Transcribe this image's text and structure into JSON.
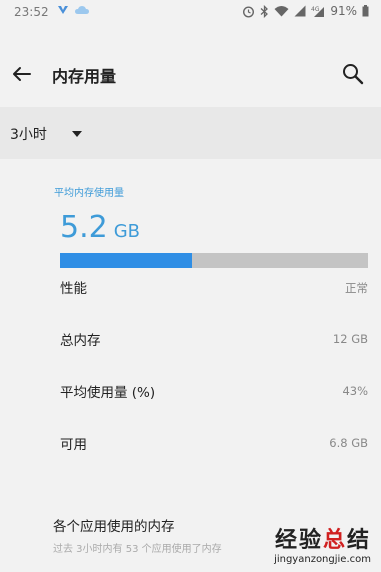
{
  "status_bar": {
    "time": "23:52",
    "battery_percent": "91%",
    "icons": [
      "vpn-icon",
      "cloud-icon",
      "alarm-icon",
      "bluetooth-icon",
      "wifi-icon",
      "signal-icon",
      "network-4g-icon",
      "battery-icon"
    ]
  },
  "toolbar": {
    "title": "内存用量",
    "back_icon": "back-arrow-icon",
    "search_icon": "search-icon"
  },
  "filter": {
    "selected": "3小时"
  },
  "summary": {
    "label": "平均内存使用量",
    "value": "5.2",
    "unit": "GB",
    "used_fraction": 0.43
  },
  "stats": [
    {
      "label": "性能",
      "value": "正常"
    },
    {
      "label": "总内存",
      "value": "12 GB"
    },
    {
      "label": "平均使用量 (%)",
      "value": "43%"
    },
    {
      "label": "可用",
      "value": "6.8 GB"
    }
  ],
  "apps_section": {
    "title": "各个应用使用的内存",
    "subtitle": "过去 3小时内有 53 个应用使用了内存"
  },
  "watermark": {
    "line1_a": "经验",
    "line1_b": "总",
    "line1_c": "结",
    "line2": "jingyanzongjie.com"
  },
  "colors": {
    "accent": "#3e9bd8",
    "bar_fill": "#2f8ee5",
    "bar_track": "#c4c4c4",
    "background": "#f2f2f2",
    "filter_bg": "#e8e8e8"
  }
}
